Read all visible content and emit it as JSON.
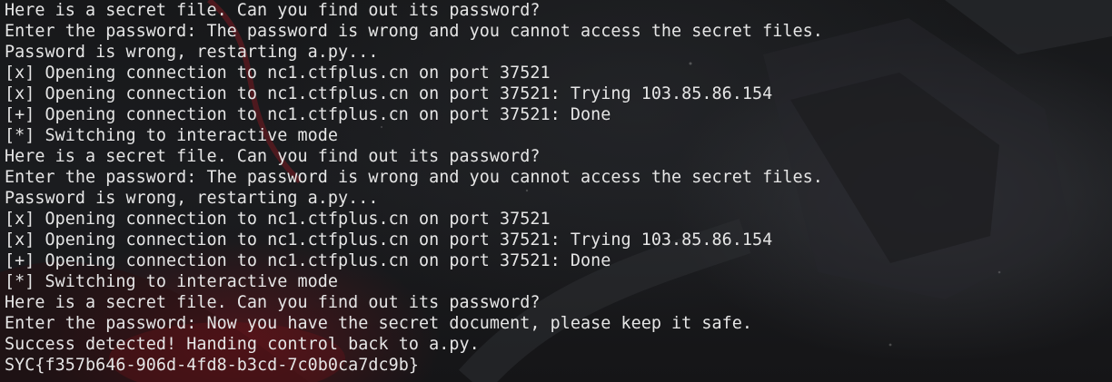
{
  "terminal": {
    "lines": [
      "Here is a secret file. Can you find out its password?",
      "Enter the password: The password is wrong and you cannot access the secret files.",
      "Password is wrong, restarting a.py...",
      "[x] Opening connection to nc1.ctfplus.cn on port 37521",
      "[x] Opening connection to nc1.ctfplus.cn on port 37521: Trying 103.85.86.154",
      "[+] Opening connection to nc1.ctfplus.cn on port 37521: Done",
      "[*] Switching to interactive mode",
      "Here is a secret file. Can you find out its password?",
      "Enter the password: The password is wrong and you cannot access the secret files.",
      "Password is wrong, restarting a.py...",
      "[x] Opening connection to nc1.ctfplus.cn on port 37521",
      "[x] Opening connection to nc1.ctfplus.cn on port 37521: Trying 103.85.86.154",
      "[+] Opening connection to nc1.ctfplus.cn on port 37521: Done",
      "[*] Switching to interactive mode",
      "Here is a secret file. Can you find out its password?",
      "Enter the password: Now you have the secret document, please keep it safe.",
      "Success detected! Handing control back to a.py.",
      "SYC{f357b646-906d-4fd8-b3cd-7c0b0ca7dc9b}"
    ]
  },
  "colors": {
    "text": "#e6e6e6",
    "background": "#17181a",
    "accent_red": "#8a1820"
  }
}
